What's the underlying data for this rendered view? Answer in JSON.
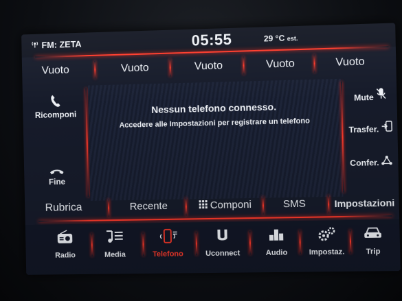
{
  "status": {
    "source": "FM: ZETA",
    "clock": "05:55",
    "temperature": "29 °C",
    "temperature_suffix": "est."
  },
  "favorites": [
    {
      "label": "Vuoto"
    },
    {
      "label": "Vuoto"
    },
    {
      "label": "Vuoto"
    },
    {
      "label": "Vuoto"
    },
    {
      "label": "Vuoto"
    }
  ],
  "phone": {
    "message_title": "Nessun telefono connesso.",
    "message_sub": "Accedere alle Impostazioni per registrare un telefono",
    "left_actions": {
      "redial_label": "Ricomponi",
      "end_label": "Fine"
    },
    "right_actions": {
      "mute_label": "Mute",
      "transfer_label": "Trasfer.",
      "conference_label": "Confer."
    },
    "tabs": {
      "rubrica": "Rubrica",
      "recente": "Recente",
      "componi": "Componi",
      "sms": "SMS",
      "impostazioni": "Impostazioni"
    }
  },
  "nav": [
    {
      "label": "Radio",
      "icon": "radio-icon"
    },
    {
      "label": "Media",
      "icon": "media-icon"
    },
    {
      "label": "Telefono",
      "icon": "phone-icon",
      "active": true
    },
    {
      "label": "Uconnect",
      "icon": "uconnect-icon"
    },
    {
      "label": "Audio",
      "icon": "audio-icon"
    },
    {
      "label": "Impostaz.",
      "icon": "settings-icon"
    },
    {
      "label": "Trip",
      "icon": "car-icon"
    }
  ],
  "colors": {
    "accent": "#ff3a2a",
    "background": "#161b2a",
    "text": "#eef1f6"
  }
}
